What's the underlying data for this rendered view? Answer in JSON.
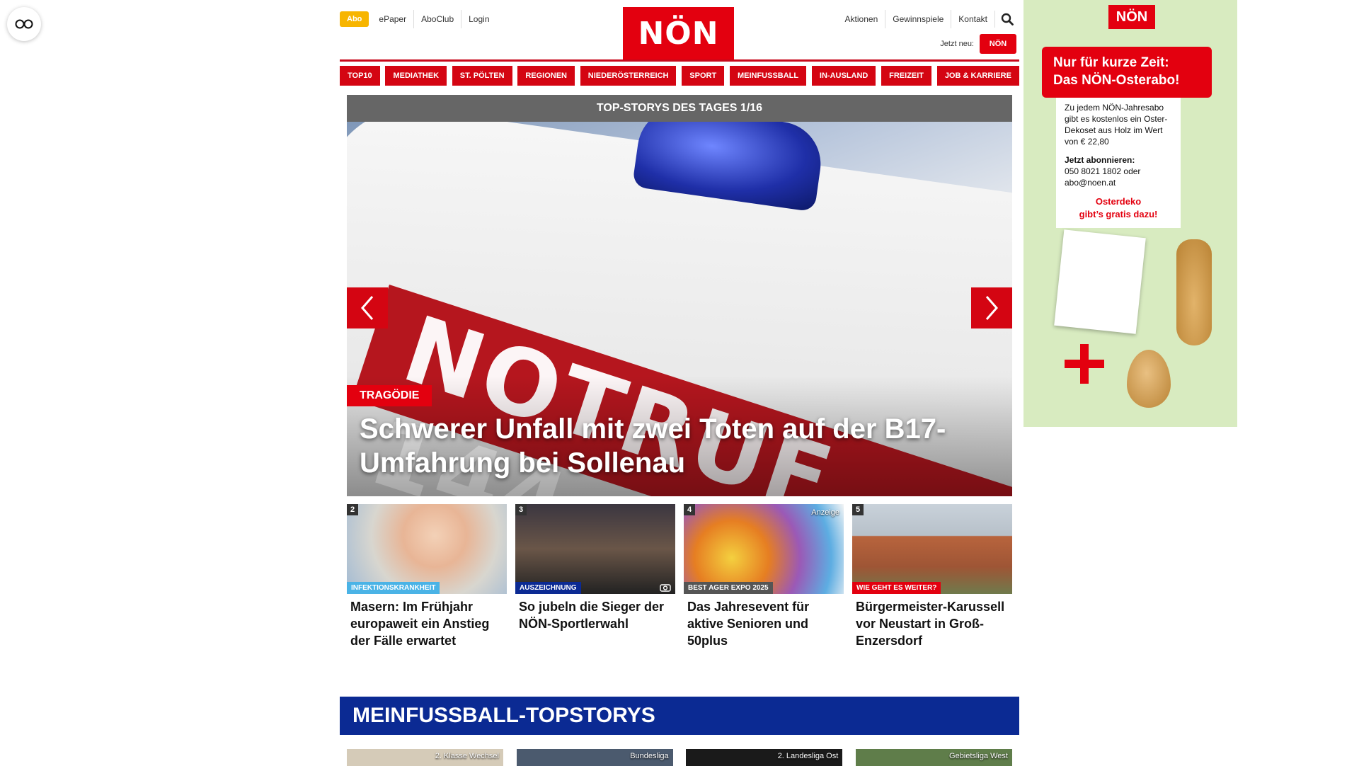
{
  "header": {
    "abo_label": "Abo",
    "left_links": [
      "ePaper",
      "AboClub",
      "Login"
    ],
    "logo_text": "NÖN",
    "right_links": [
      "Aktionen",
      "Gewinnspiele",
      "Kontakt"
    ],
    "jetzt_neu_label": "Jetzt neu:",
    "jetzt_neu_logo": "NÖN"
  },
  "nav": {
    "items": [
      "TOP10",
      "MEDIATHEK",
      "ST. PÖLTEN",
      "REGIONEN",
      "NIEDERÖSTERREICH",
      "SPORT",
      "MEINFUSSBALL",
      "IN-AUSLAND",
      "FREIZEIT",
      "JOB & KARRIERE"
    ]
  },
  "slider": {
    "header": "TOP-STORYS DES TAGES 1/16",
    "image_text": "NOTRUF 144",
    "category": "TRAGÖDIE",
    "title": "Schwerer Unfall mit zwei Toten auf der B17-Umfahrung bei Sollenau"
  },
  "cards": [
    {
      "number": "2",
      "tag": "INFEKTIONSKRANKHEIT",
      "tag_color": "#4ab3e6",
      "title": "Masern: Im Frühjahr europaweit ein Anstieg der Fälle erwartet",
      "advert": ""
    },
    {
      "number": "3",
      "tag": "AUSZEICHNUNG",
      "tag_color": "#0b2a93",
      "title": "So jubeln die Sieger der NÖN-Sportlerwahl",
      "advert": ""
    },
    {
      "number": "4",
      "tag": "BEST AGER EXPO 2025",
      "tag_color": "#555555",
      "title": "Das Jahresevent für aktive Senioren und 50plus",
      "advert": "Anzeige"
    },
    {
      "number": "5",
      "tag": "WIE GEHT ES WEITER?",
      "tag_color": "#e3000f",
      "title": "Bürgermeister-Karussell vor Neustart in Groß-Enzersdorf",
      "advert": ""
    }
  ],
  "meinfussball": {
    "title": "MEINFUSSBALL-TOPSTORYS",
    "labels": [
      "2. Klasse Wechsel",
      "Bundesliga",
      "2. Landesliga Ost",
      "Gebietsliga West"
    ]
  },
  "ad": {
    "logo": "NÖN",
    "headline_1": "Nur für kurze Zeit:",
    "headline_2": "Das NÖN-Osterabo!",
    "body": "Zu jedem NÖN-Jahresabo gibt es kostenlos ein Oster-Dekoset aus Holz im Wert von € 22,80",
    "cta_title": "Jetzt abonnieren:",
    "cta_text": "050 8021 1802 oder abo@noen.at",
    "red_line_1": "Osterdeko",
    "red_line_2": "gibt’s gratis dazu!"
  },
  "colors": {
    "brand_red": "#e3000f",
    "nav_red": "#d40512",
    "fussball_blue": "#0b2a93",
    "abo_yellow": "#f7b500"
  }
}
